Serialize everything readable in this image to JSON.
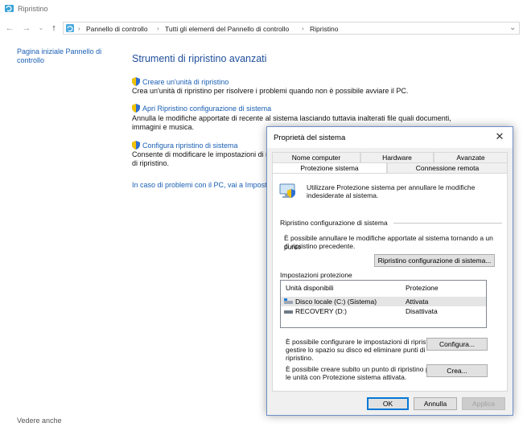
{
  "window": {
    "title": "Ripristino"
  },
  "address": {
    "crumbs": [
      "Pannello di controllo",
      "Tutti gli elementi del Pannello di controllo",
      "Ripristino"
    ]
  },
  "leftnav": {
    "home_link": "Pagina iniziale Pannello di controllo",
    "see_also": "Vedere anche"
  },
  "main": {
    "heading": "Strumenti di ripristino avanzati",
    "items": [
      {
        "link": "Creare un'unità di ripristino",
        "desc": [
          "Crea un'unità di ripristino per risolvere i problemi quando non è possibile avviare il PC."
        ]
      },
      {
        "link": "Apri Ripristino configurazione di sistema",
        "desc": [
          "Annulla le modifiche apportate di recente al sistema lasciando tuttavia inalterati file quali documenti,",
          "immagini e musica."
        ]
      },
      {
        "link": "Configura ripristino di sistema",
        "desc": [
          "Consente di modificare le impostazioni di ri",
          "di ripristino."
        ]
      }
    ],
    "reset_link": "In caso di problemi con il PC, vai a Imposta"
  },
  "dialog": {
    "title": "Proprietà del sistema",
    "tabs_row1": [
      "Nome computer",
      "Hardware",
      "Avanzate"
    ],
    "tabs_row2": [
      "Protezione sistema",
      "Connessione remota"
    ],
    "intro": [
      "Utilizzare Protezione sistema per annullare le modifiche",
      "indesiderate al sistema."
    ],
    "restore_section": "Ripristino configurazione di sistema",
    "restore_desc": [
      "È possibile annullare le modifiche apportate al sistema tornando a un punto",
      "di ripristino precedente."
    ],
    "restore_button": "Ripristino configurazione di sistema...",
    "protection_section": "Impostazioni protezione",
    "list_headers": [
      "Unità disponibili",
      "Protezione"
    ],
    "drives": [
      {
        "name": "Disco locale (C:) (Sistema)",
        "status": "Attivata"
      },
      {
        "name": "RECOVERY (D:)",
        "status": "Disattivata"
      }
    ],
    "configure_text": [
      "È possibile configurare le impostazioni di ripristino,",
      "gestire lo spazio su disco ed eliminare punti di",
      "ripristino."
    ],
    "configure_button": "Configura...",
    "create_text": [
      "È possibile creare subito un punto di ripristino per",
      "le unità con Protezione sistema attivata."
    ],
    "create_button": "Crea...",
    "ok": "OK",
    "cancel": "Annulla",
    "apply": "Applica"
  }
}
